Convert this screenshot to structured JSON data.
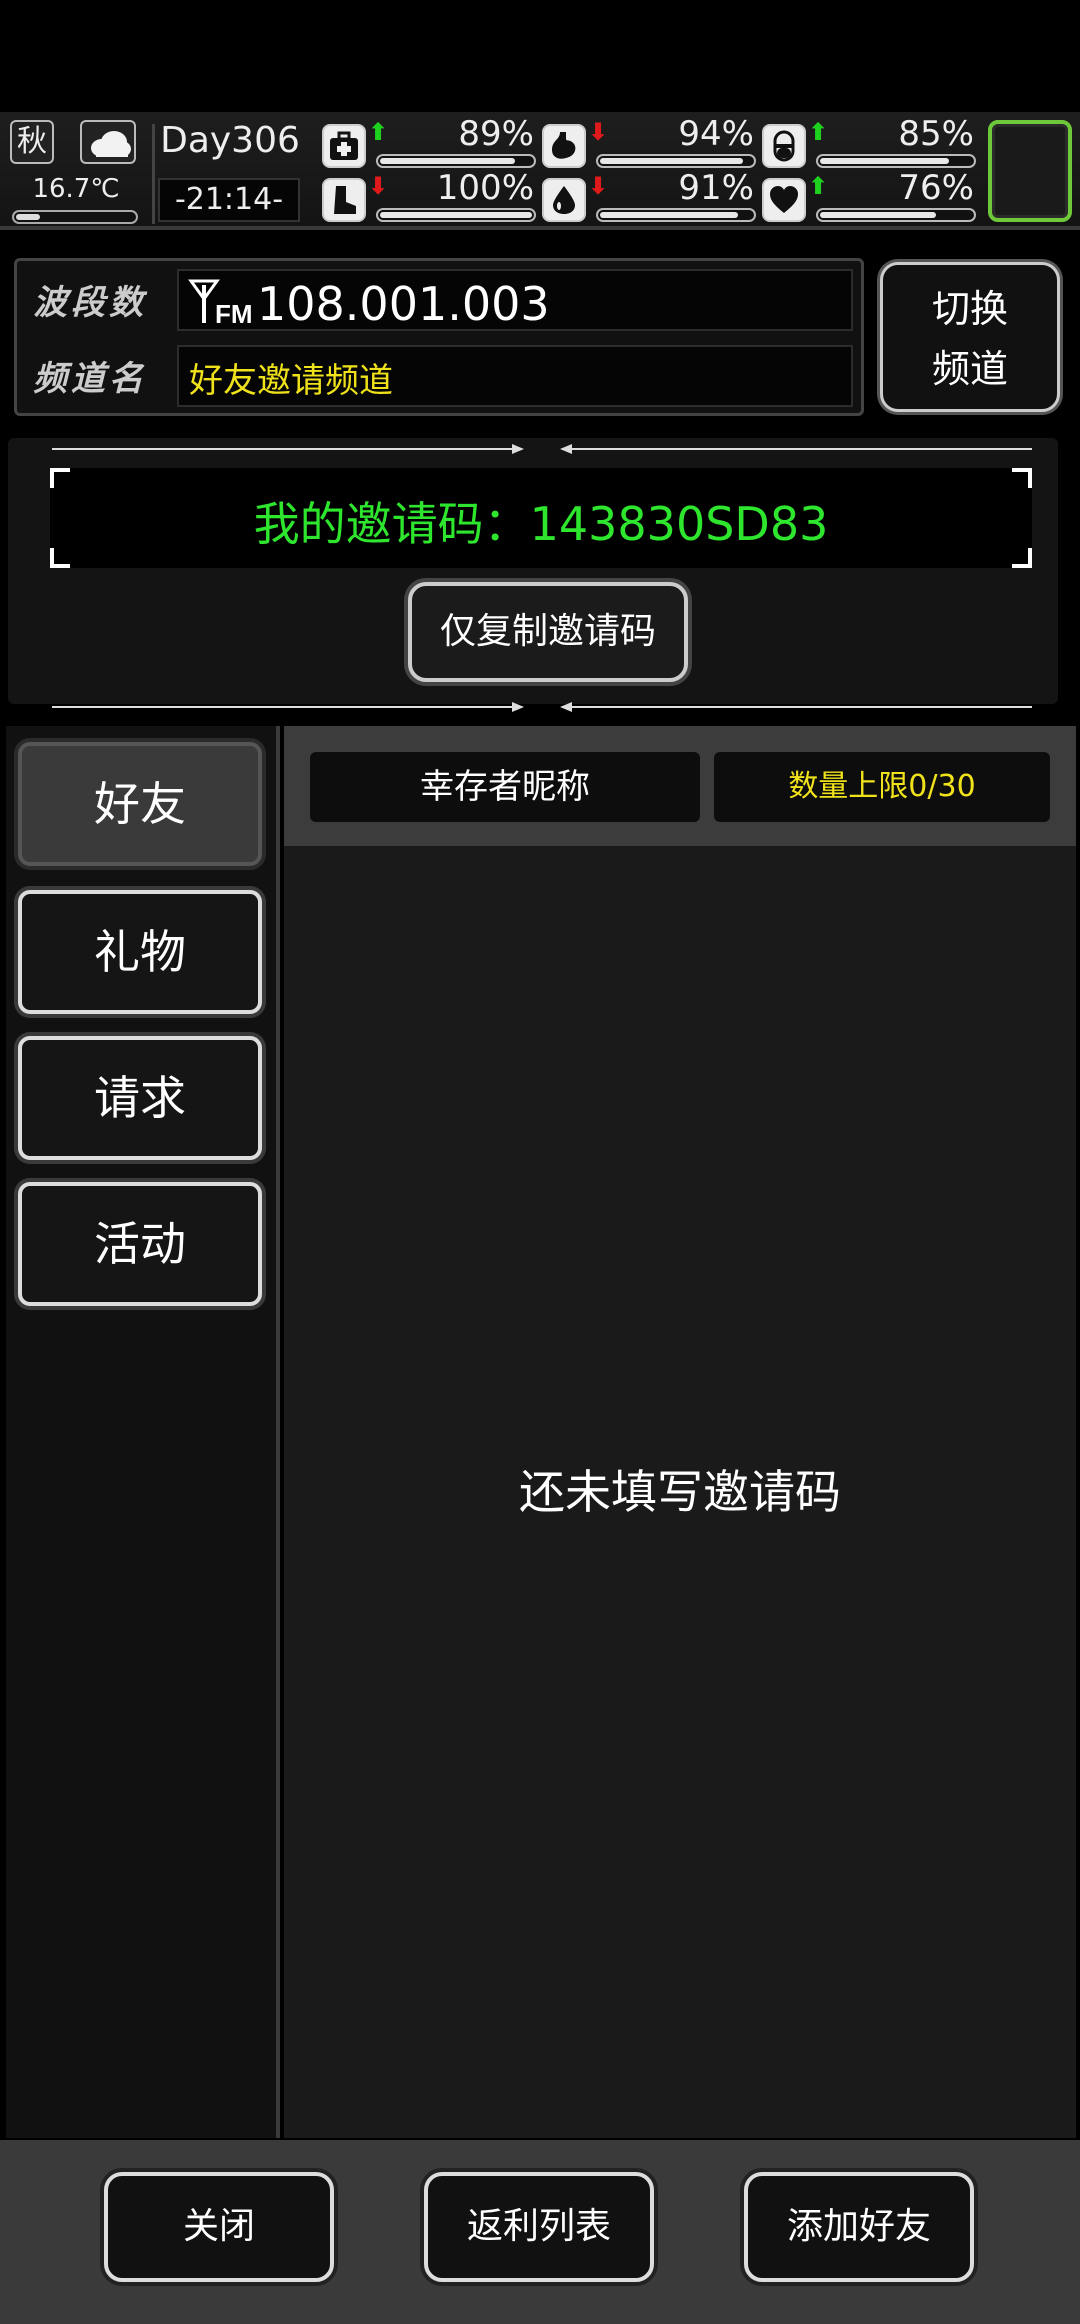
{
  "hud": {
    "season": "秋",
    "temperature": "16.7℃",
    "temperature_level": 0.2,
    "day": "Day306",
    "time": "-21:14-",
    "stats": [
      {
        "icon": "medkit-icon",
        "trend": "up",
        "value": "89%",
        "level": 0.89
      },
      {
        "icon": "stomach-icon",
        "trend": "down",
        "value": "94%",
        "level": 0.94
      },
      {
        "icon": "pill-icon",
        "trend": "up",
        "value": "85%",
        "level": 0.85
      },
      {
        "icon": "boot-icon",
        "trend": "down",
        "value": "100%",
        "level": 1.0
      },
      {
        "icon": "water-drop-icon",
        "trend": "down",
        "value": "91%",
        "level": 0.91
      },
      {
        "icon": "heart-icon",
        "trend": "up",
        "value": "76%",
        "level": 0.76
      }
    ]
  },
  "radio": {
    "band_label": "波段数",
    "channel_label": "频道名",
    "frequency": "108.001.003",
    "channel_name": "好友邀请频道",
    "switch_line1": "切换",
    "switch_line2": "频道"
  },
  "invite": {
    "code_text": "我的邀请码：143830SD83",
    "copy_button": "仅复制邀请码"
  },
  "sidebar": {
    "items": [
      {
        "label": "好友",
        "active": true
      },
      {
        "label": "礼物",
        "active": false
      },
      {
        "label": "请求",
        "active": false
      },
      {
        "label": "活动",
        "active": false
      }
    ]
  },
  "content": {
    "col_nickname": "幸存者昵称",
    "col_limit": "数量上限0/30",
    "empty_message": "还未填写邀请码"
  },
  "bottom": {
    "close": "关闭",
    "rebate_list": "返利列表",
    "add_friend": "添加好友"
  },
  "colors": {
    "code_green": "#2ee62e",
    "channel_yellow": "#f0e21a",
    "limit_yellow": "#f0e21a",
    "slot_green": "#6ec83a",
    "arrow_up": "#1fd11f",
    "arrow_down": "#e01a1a"
  }
}
